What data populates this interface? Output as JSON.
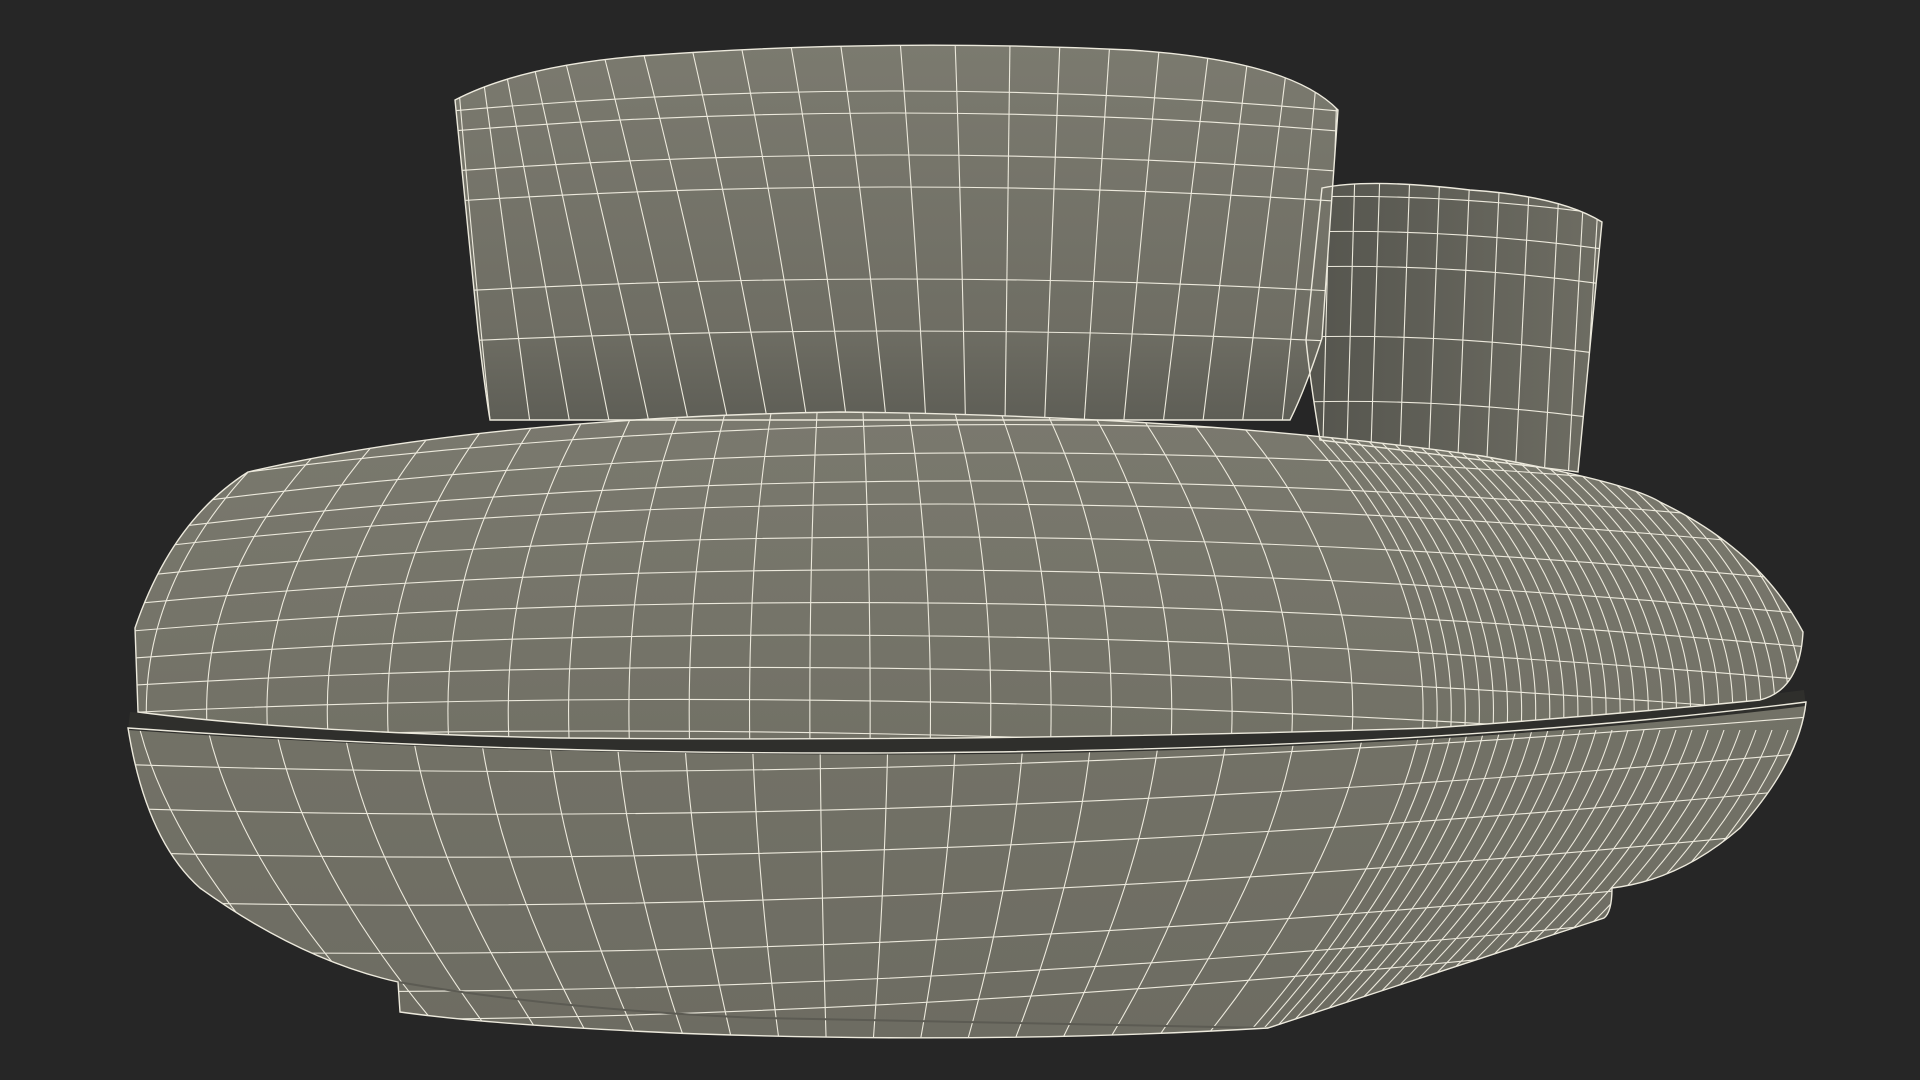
{
  "scene": {
    "background_color": "#262626",
    "surface_color": "#767569",
    "surface_shadow_color": "#5a5a52",
    "gap_color": "#2f2f2c",
    "wire_color": "#ece9dc",
    "objects": [
      {
        "name": "backrest-cushion",
        "kind": "cylindrical-panel"
      },
      {
        "name": "side-armrest-cushion",
        "kind": "cylindrical-panel"
      },
      {
        "name": "seat-cushion",
        "kind": "rounded-cushion"
      },
      {
        "name": "base",
        "kind": "rounded-base"
      }
    ]
  }
}
